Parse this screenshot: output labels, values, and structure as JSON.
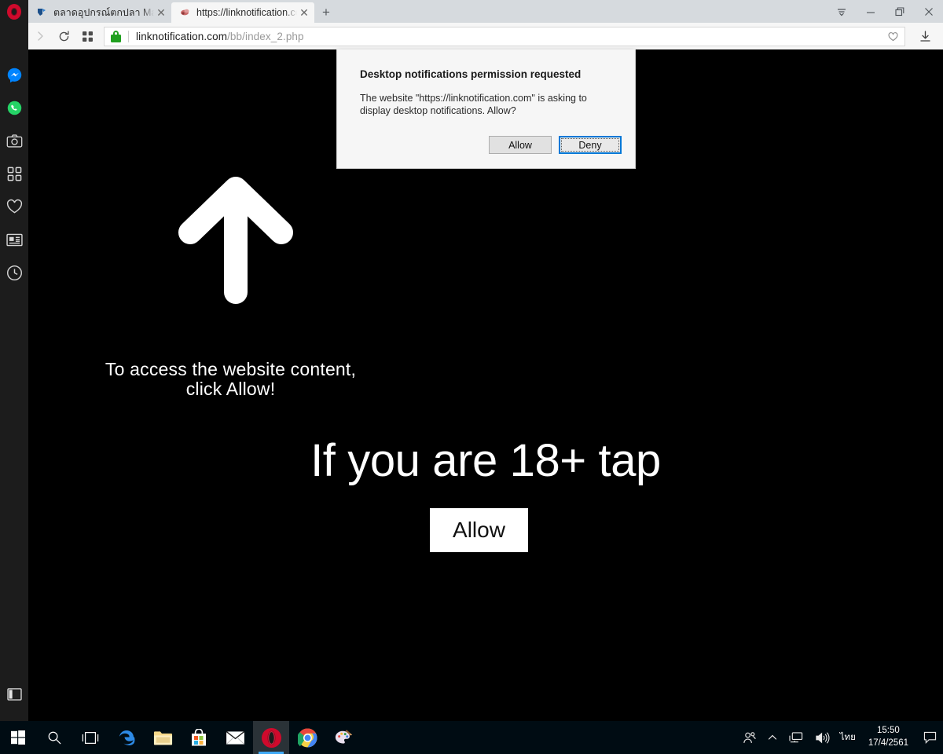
{
  "browser": {
    "name": "Opera",
    "logo_icon": "opera-logo-icon",
    "tabs": [
      {
        "title": "ตลาดอุปกรณ์ตกปลา Market",
        "favicon": "fish-market-favicon",
        "active": false
      },
      {
        "title": "https://linknotification.com",
        "favicon": "site-favicon",
        "active": true
      }
    ],
    "new_tab_label": "+",
    "tab_close_label": "✕",
    "window_controls": [
      {
        "name": "opera-menu-button",
        "icon": "menu-chevron-icon"
      },
      {
        "name": "minimize-button",
        "icon": "minimize-icon"
      },
      {
        "name": "maximize-button",
        "icon": "restore-icon"
      },
      {
        "name": "close-button",
        "icon": "close-icon"
      }
    ],
    "navigation": {
      "back_icon": "back-arrow-icon",
      "forward_icon": "forward-arrow-icon",
      "reload_icon": "reload-icon",
      "speeddial_icon": "speed-dial-grid-icon"
    },
    "address_bar": {
      "security_icon": "padlock-icon",
      "url_host": "linknotification.com",
      "url_path": "/bb/index_2.php",
      "bookmark_icon": "heart-icon"
    },
    "download_icon": "download-icon",
    "sidebar": {
      "items": [
        {
          "name": "sidebar-item-messenger",
          "icon": "messenger-icon",
          "label": "Messenger"
        },
        {
          "name": "sidebar-item-whatsapp",
          "icon": "whatsapp-icon",
          "label": "WhatsApp"
        },
        {
          "name": "sidebar-item-snapshot",
          "icon": "camera-icon",
          "label": "Snapshot"
        },
        {
          "name": "sidebar-item-extensions",
          "icon": "grid-icon",
          "label": "Extensions"
        },
        {
          "name": "sidebar-item-bookmarks",
          "icon": "heart-icon",
          "label": "Bookmarks"
        },
        {
          "name": "sidebar-item-news",
          "icon": "news-icon",
          "label": "News"
        },
        {
          "name": "sidebar-item-history",
          "icon": "clock-icon",
          "label": "History"
        }
      ],
      "toggle": {
        "name": "sidebar-toggle",
        "icon": "panel-toggle-icon",
        "label": "Toggle sidebar"
      }
    }
  },
  "dialog": {
    "title": "Desktop notifications permission requested",
    "body": "The website \"https://linknotification.com\" is asking to display desktop notifications. Allow?",
    "allow_label": "Allow",
    "deny_label": "Deny",
    "focused_button": "Deny"
  },
  "page": {
    "background_color": "#000000",
    "arrow_icon": "up-arrow-icon",
    "instruction_line1": "To access the website content,",
    "instruction_line2": "click Allow!",
    "headline": "If you are 18+ tap",
    "allow_button_label": "Allow"
  },
  "taskbar": {
    "items": [
      {
        "name": "start-button",
        "icon": "windows-logo-icon",
        "active": false,
        "running": false
      },
      {
        "name": "search-button",
        "icon": "search-icon",
        "active": false,
        "running": false
      },
      {
        "name": "task-view-button",
        "icon": "task-view-icon",
        "active": false,
        "running": false
      },
      {
        "name": "taskbar-edge",
        "icon": "edge-icon",
        "active": false,
        "running": false
      },
      {
        "name": "taskbar-file-explorer",
        "icon": "folder-icon",
        "active": false,
        "running": false
      },
      {
        "name": "taskbar-store",
        "icon": "store-icon",
        "active": false,
        "running": false
      },
      {
        "name": "taskbar-mail",
        "icon": "mail-icon",
        "active": false,
        "running": false
      },
      {
        "name": "taskbar-opera",
        "icon": "opera-logo-icon",
        "active": true,
        "running": true
      },
      {
        "name": "taskbar-chrome",
        "icon": "chrome-icon",
        "active": false,
        "running": true
      },
      {
        "name": "taskbar-paint3d",
        "icon": "paint3d-icon",
        "active": false,
        "running": true
      }
    ],
    "tray": {
      "people_icon": "people-icon",
      "chevron_icon": "show-hidden-icons-icon",
      "network_icon": "network-icon",
      "volume_icon": "volume-icon",
      "language": "ไทย",
      "time": "15:50",
      "date": "17/4/2561",
      "action_center_icon": "action-center-icon"
    }
  }
}
